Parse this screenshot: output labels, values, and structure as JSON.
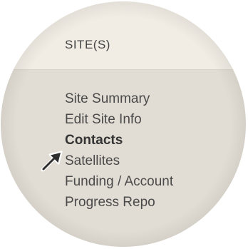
{
  "section": {
    "title": "SITE(S)"
  },
  "nav": {
    "items": [
      {
        "label": "Site Summary",
        "active": false
      },
      {
        "label": "Edit Site Info",
        "active": false
      },
      {
        "label": "Contacts",
        "active": true
      },
      {
        "label": "Satellites",
        "active": false
      },
      {
        "label": "Funding / Account",
        "active": false
      },
      {
        "label": "Progress Repo",
        "active": false
      }
    ]
  },
  "pointer": {
    "icon": "arrow-pointer-icon",
    "color": "#2f2f2f"
  },
  "colors": {
    "header_background": "#f1ede5",
    "menu_background": "#e2ddd4",
    "text": "#4a4a4a"
  }
}
